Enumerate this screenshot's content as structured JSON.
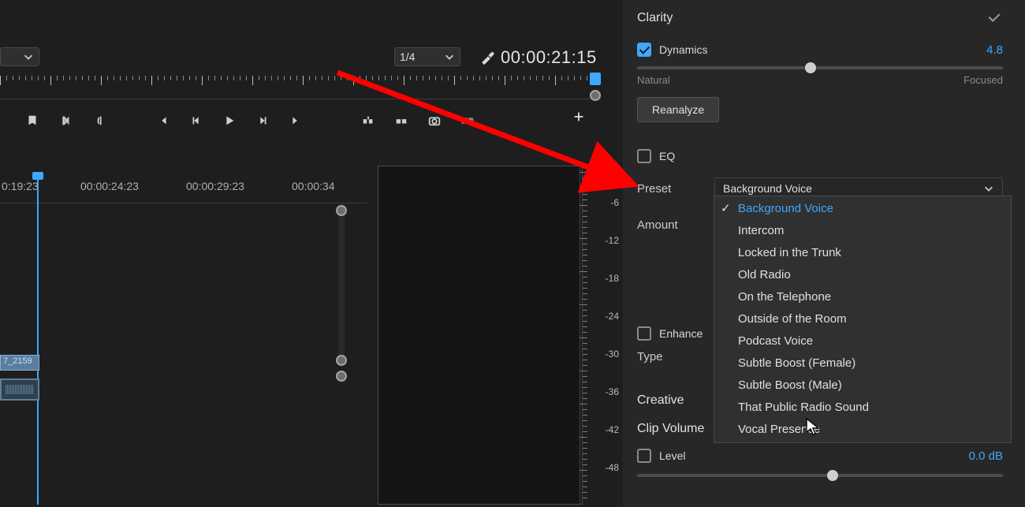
{
  "toolbar": {
    "ratio_select": "1/4",
    "timecode": "00:00:21:15"
  },
  "timeline": {
    "timecodes": [
      "0:19:23",
      "00:00:24:23",
      "00:00:29:23",
      "00:00:34"
    ],
    "clip_name": "7_2159"
  },
  "meter": {
    "db_labels": [
      "-6",
      "-12",
      "-18",
      "-24",
      "-30",
      "-36",
      "-42",
      "-48"
    ]
  },
  "panel": {
    "clarity": {
      "label": "Clarity"
    },
    "dynamics": {
      "label": "Dynamics",
      "value": "4.8",
      "slider_left": "Natural",
      "slider_right": "Focused",
      "reanalyze": "Reanalyze"
    },
    "eq": {
      "label": "EQ",
      "preset_label": "Preset",
      "preset_value": "Background Voice",
      "amount_label": "Amount",
      "options": [
        "Background Voice",
        "Intercom",
        "Locked in the Trunk",
        "Old Radio",
        "On the Telephone",
        "Outside of the Room",
        "Podcast Voice",
        "Subtle Boost (Female)",
        "Subtle Boost (Male)",
        "That Public Radio Sound",
        "Vocal Presence"
      ]
    },
    "enhance": {
      "label": "Enhance",
      "type_label": "Type"
    },
    "creative": {
      "label": "Creative"
    },
    "clip_volume": {
      "label": "Clip Volume",
      "level_label": "Level",
      "level_value": "0.0 dB"
    }
  }
}
